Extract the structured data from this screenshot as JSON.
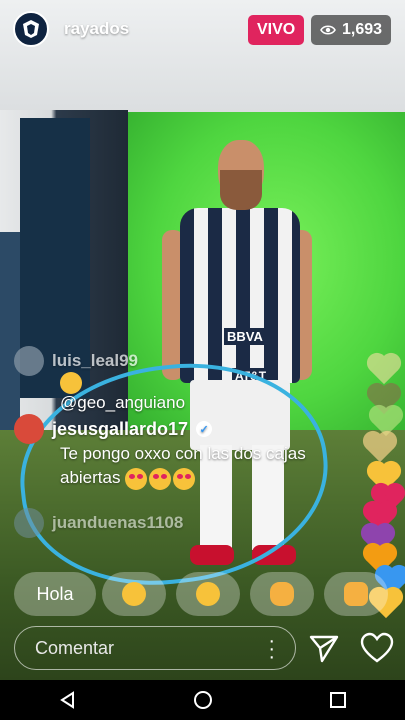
{
  "header": {
    "account_name": "rayados",
    "avatar_text": "",
    "live_label": "VIVO",
    "viewer_count": "1,693"
  },
  "comments": [
    {
      "user": "luis_leal99",
      "text": ""
    },
    {
      "user": "@geo_anguiano",
      "text": ""
    },
    {
      "user": "jesusgallardo17",
      "verified": true,
      "text": "Te pongo oxxo con las dos cajas abiertas"
    },
    {
      "user": "juanduenas1108",
      "text": ""
    }
  ],
  "quick_replies": [
    {
      "type": "text",
      "label": "Hola"
    },
    {
      "type": "emoji",
      "icon": "grinning-face-icon"
    },
    {
      "type": "emoji",
      "icon": "heart-eyes-face-icon"
    },
    {
      "type": "emoji",
      "icon": "waving-hand-icon"
    },
    {
      "type": "emoji",
      "icon": "thumbs-up-icon"
    }
  ],
  "composer": {
    "placeholder": "Comentar"
  },
  "colors": {
    "live": "#e0245e",
    "highlight_circle": "#3ab2e0",
    "hearts": [
      "#f6d28a",
      "#8bbf60",
      "#f7c23a",
      "#e0245e",
      "#8e44ad",
      "#f39c12",
      "#3897f0"
    ]
  }
}
